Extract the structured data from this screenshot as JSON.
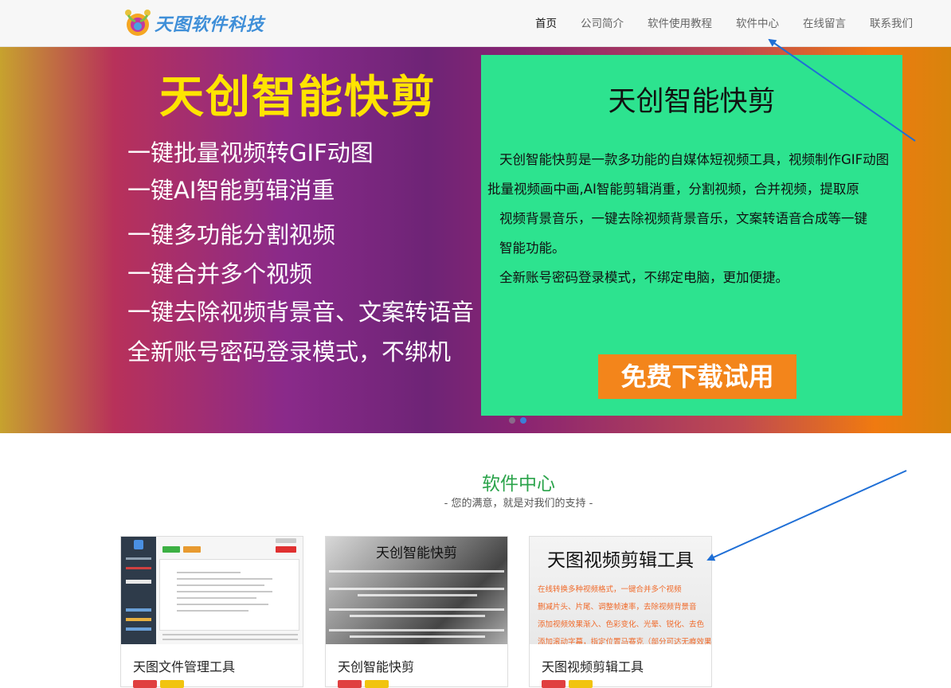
{
  "header": {
    "logo_text": "天图软件科技",
    "nav": [
      "首页",
      "公司简介",
      "软件使用教程",
      "软件中心",
      "在线留言",
      "联系我们"
    ]
  },
  "banner": {
    "title": "天创智能快剪",
    "lines": [
      "一键批量视频转GIF动图",
      "一键AI智能剪辑消重",
      "一键多功能分割视频",
      "一键合并多个视频",
      "一键去除视频背景音、文案转语音",
      "全新账号密码登录模式，不绑机"
    ],
    "card": {
      "title": "天创智能快剪",
      "paragraphs": [
        "天创智能快剪是一款多功能的自媒体短视频工具，视频制作GIF动图",
        "批量视频画中画,AI智能剪辑消重，分割视频，合并视频，提取原",
        "视频背景音乐，一键去除视频背景音乐，文案转语音合成等一键",
        "智能功能。",
        "全新账号密码登录模式，不绑定电脑，更加便捷。"
      ],
      "button": "免费下载试用"
    }
  },
  "section": {
    "title": "软件中心",
    "subtitle": "- 您的满意，就是对我们的支持 -"
  },
  "cards": [
    {
      "name": "天图文件管理工具"
    },
    {
      "name": "天创智能快剪",
      "thumb_title": "天创智能快剪"
    },
    {
      "name": "天图视频剪辑工具",
      "thumb_title": "天图视频剪辑工具",
      "thumb_lines": [
        "在线转换多种视频格式，一键合并多个视频",
        "删减片头、片尾、调整帧速率，去除视频背景音",
        "添加视频效果渐入、色彩变化、光晕、锐化、去色",
        "添加滚动字幕，指定位置马赛克（部分可达无痕效果）"
      ]
    }
  ],
  "colors": {
    "accent_green": "#2aa34a",
    "banner_card": "#2de38f",
    "cta": "#f3851b",
    "arrow": "#1f6fd6"
  }
}
